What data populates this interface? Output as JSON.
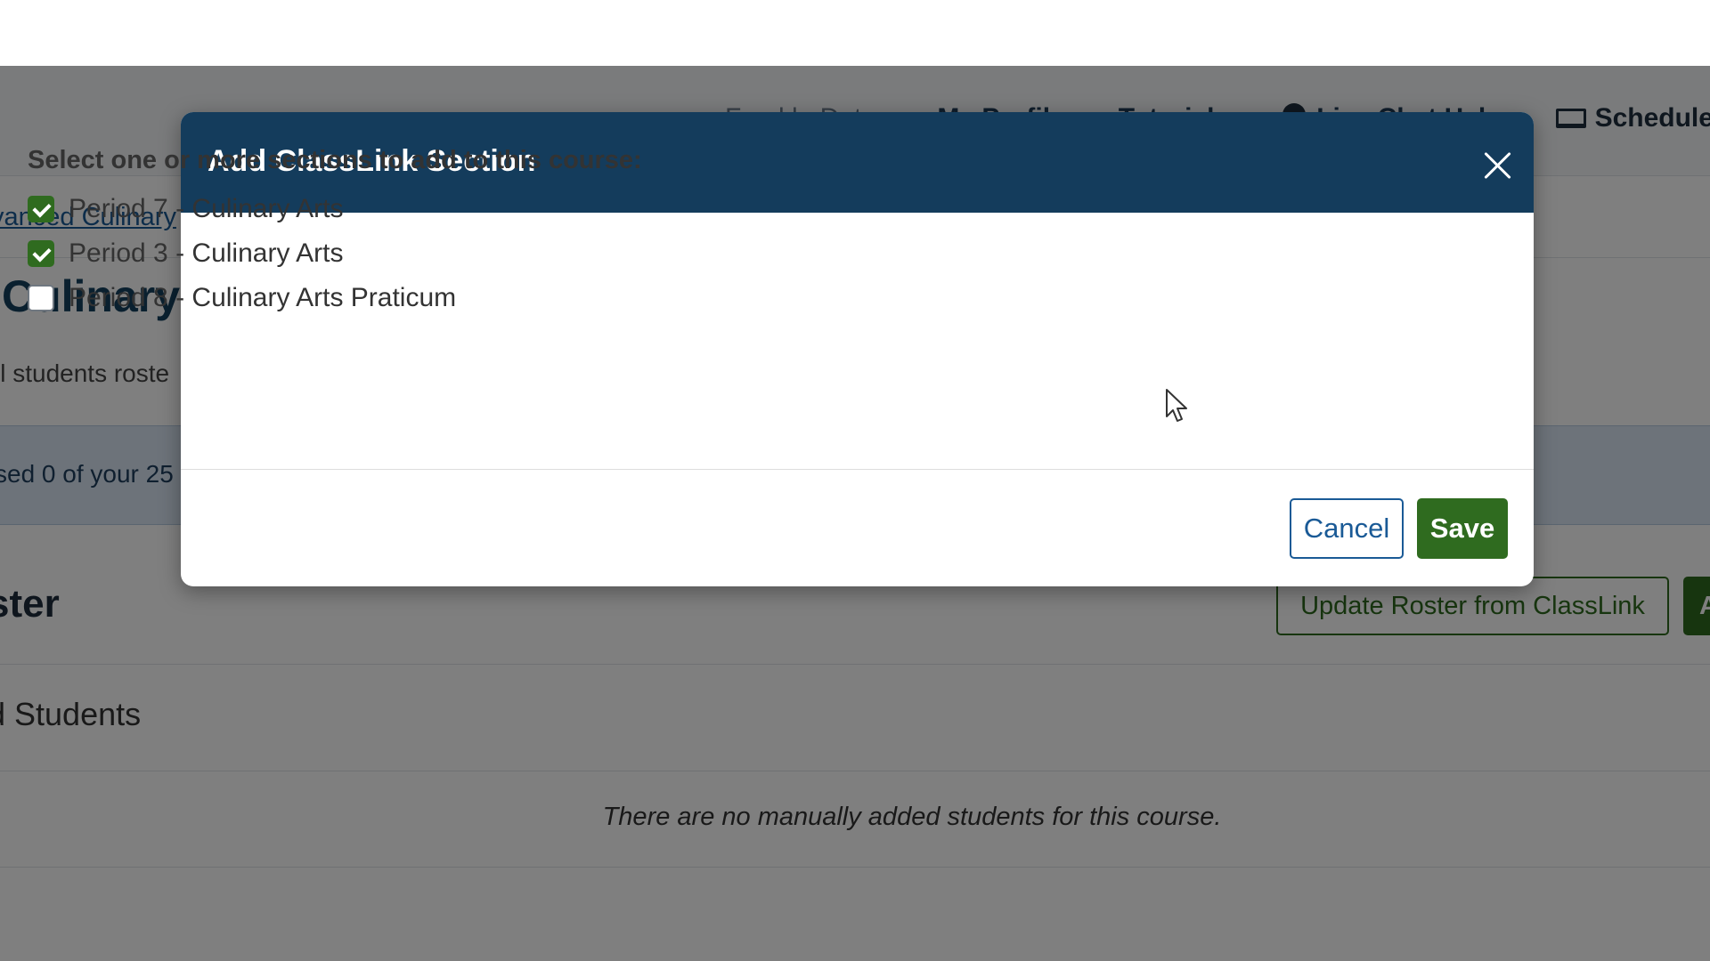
{
  "header": {
    "links": [
      "Freckle Dat...",
      "My Profile",
      "Tutorials",
      "Live Chat Help"
    ],
    "schedule_label": "Schedule C"
  },
  "breadcrumb": {
    "link": "vanced Culinary"
  },
  "course": {
    "title": "Culinary",
    "roster_note": "ll students roste",
    "info": "sed 0 of your 25"
  },
  "roster": {
    "heading": "ster",
    "update_button": "Update Roster from ClassLink",
    "add_button_partial": "A",
    "students_heading": "d Students",
    "empty_message": "There are no manually added students for this course."
  },
  "modal": {
    "title": "Add ClassLink Section",
    "prompt": "Select one or more sections to add to this course:",
    "options": [
      {
        "label": "Period 7 - Culinary Arts",
        "checked": true
      },
      {
        "label": "Period 3 - Culinary Arts",
        "checked": true
      },
      {
        "label": "Period 8 - Culinary Arts Praticum",
        "checked": false
      }
    ],
    "cancel_label": "Cancel",
    "save_label": "Save"
  },
  "colors": {
    "modal_header": "#143c5c",
    "primary_green": "#2f6b1f",
    "link_blue": "#1a5a96"
  }
}
